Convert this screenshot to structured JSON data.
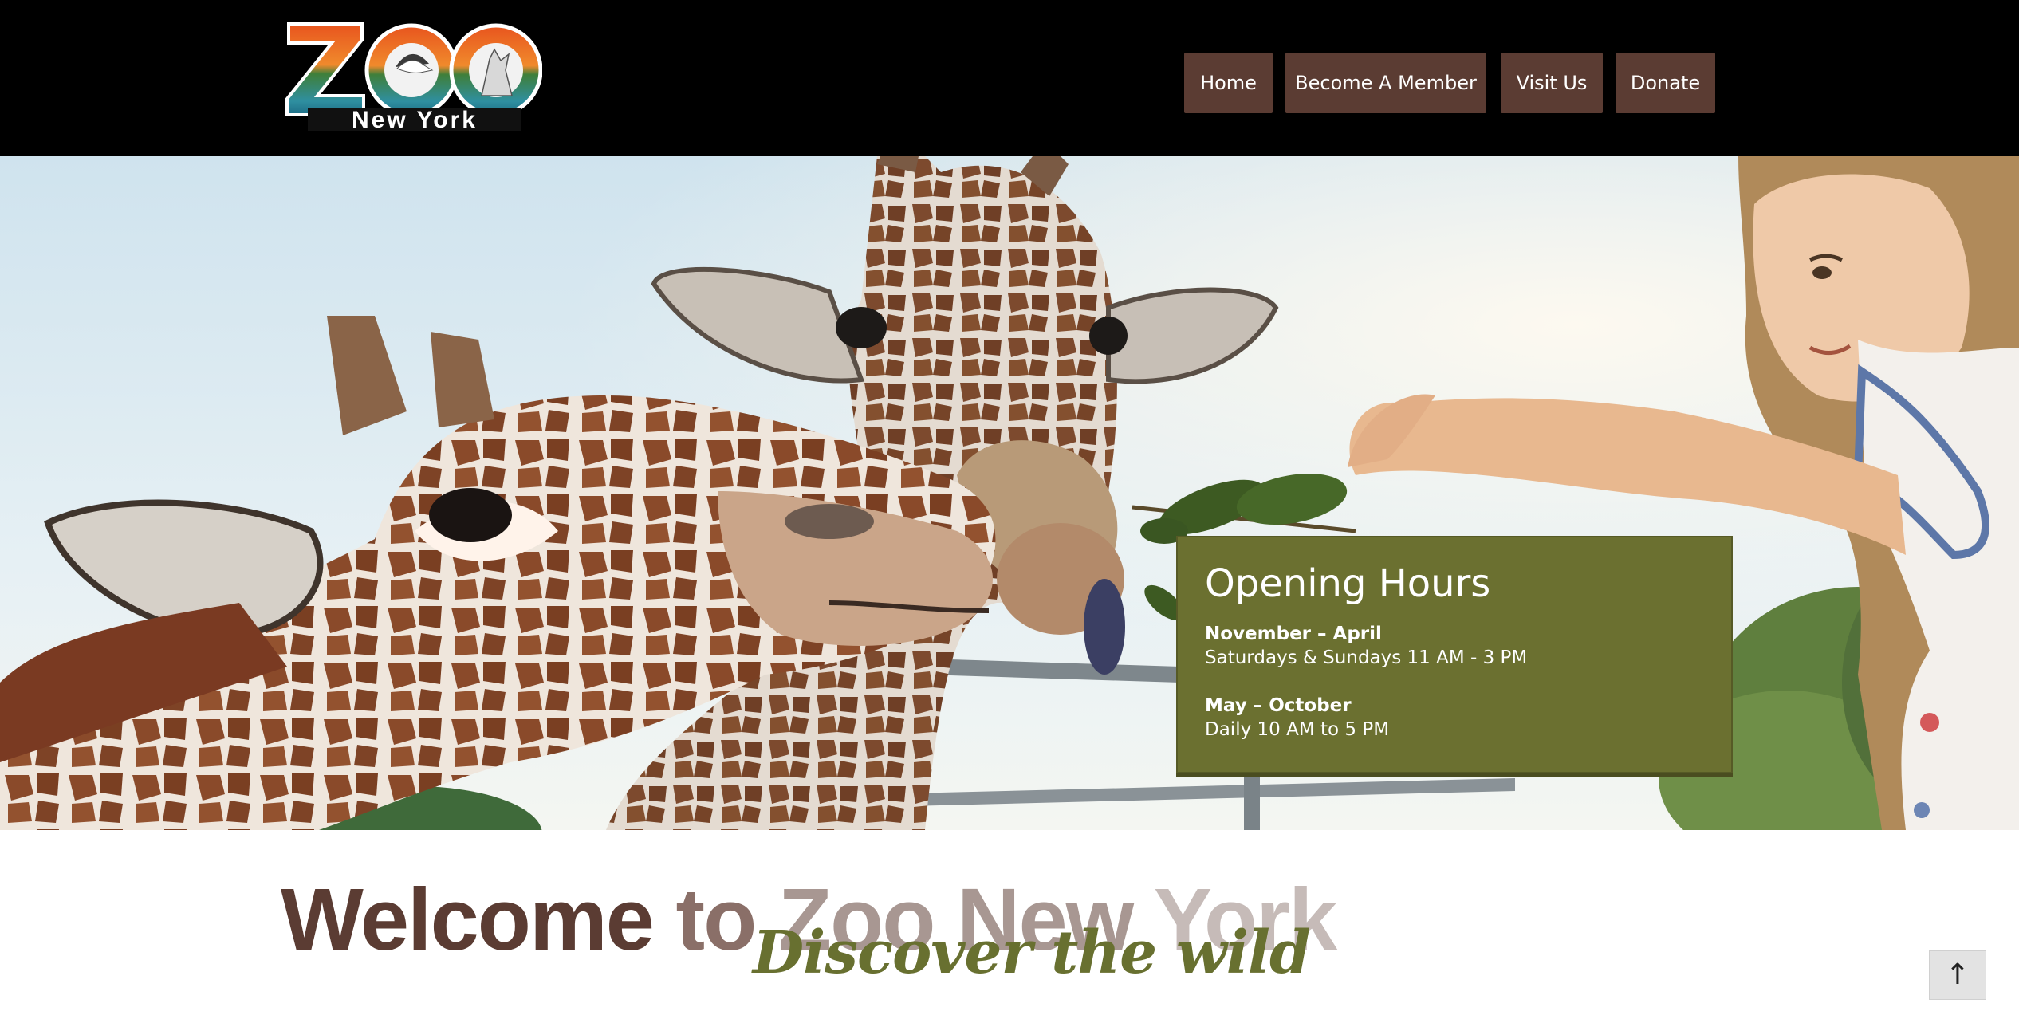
{
  "header": {
    "logo": {
      "word": "ZOO",
      "subtitle": "New York"
    },
    "nav": [
      {
        "label": "Home"
      },
      {
        "label": "Become A Member"
      },
      {
        "label": "Visit Us"
      },
      {
        "label": "Donate"
      }
    ]
  },
  "hours": {
    "title": "Opening Hours",
    "schedules": [
      {
        "season": "November – April",
        "times": "Saturdays & Sundays 11 AM - 3 PM"
      },
      {
        "season": "May – October",
        "times": "Daily 10 AM to 5 PM"
      }
    ]
  },
  "welcome": {
    "part1": "Welcome",
    "part2": "to",
    "part3": "Zoo New",
    "part4": "York",
    "tagline": "Discover the wild"
  },
  "back_to_top": {
    "label": "↑"
  },
  "colors": {
    "header_bg": "#000000",
    "nav_bg": "#5b3c33",
    "hours_bg": "#6b7030",
    "tagline": "#687030",
    "welcome": "#5b3c33"
  },
  "icons": {
    "back_to_top": "arrow-up-icon"
  }
}
